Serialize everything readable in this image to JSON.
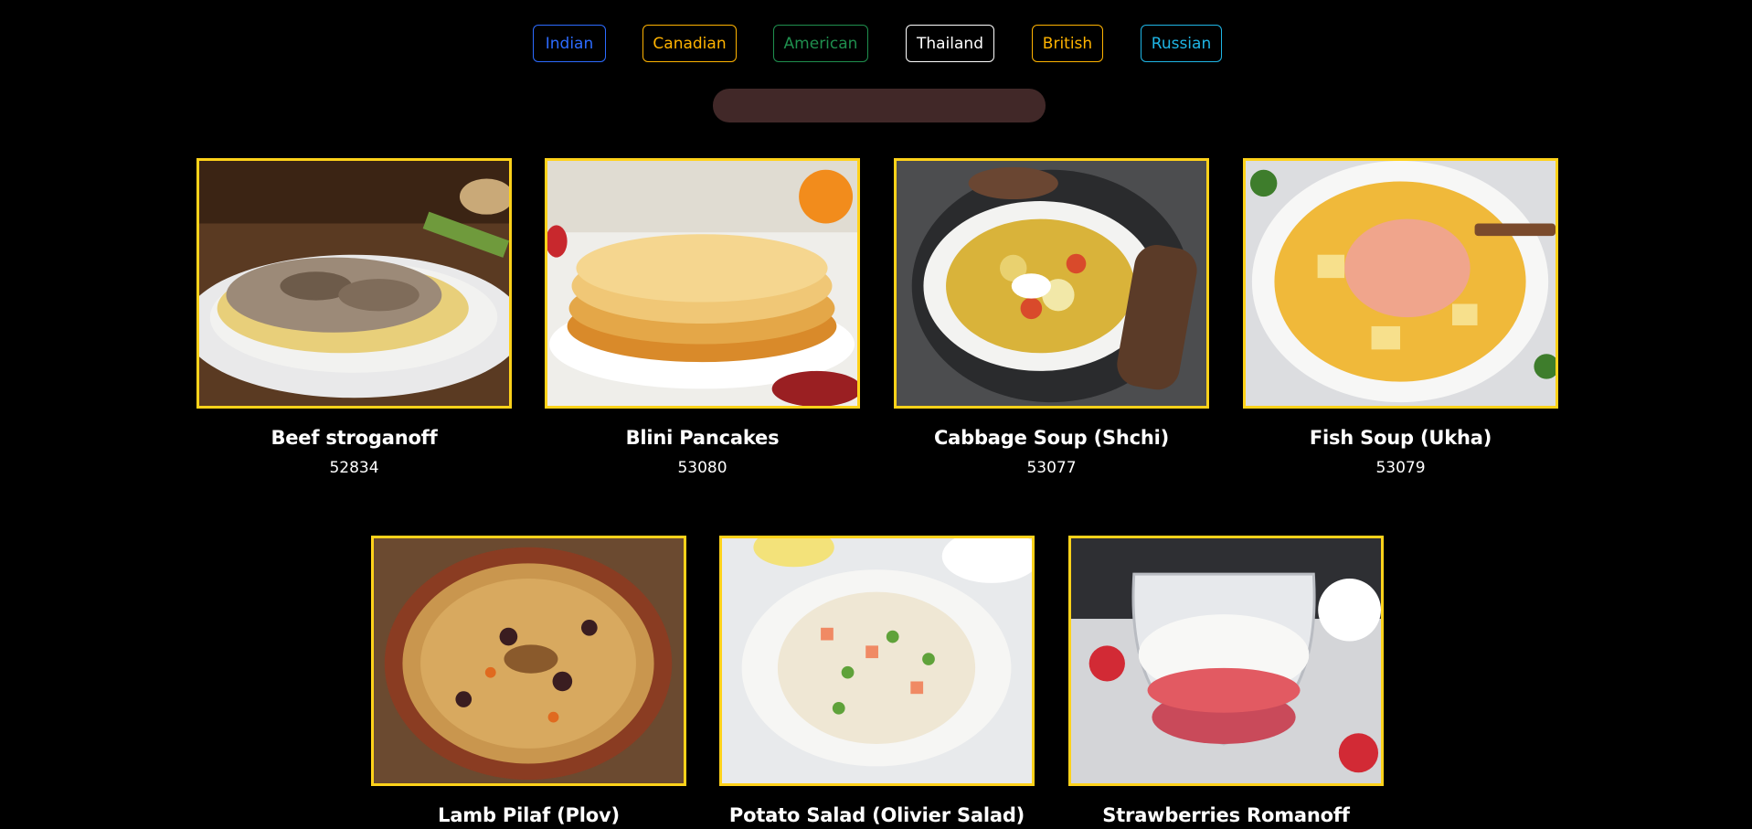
{
  "filters": [
    {
      "label": "Indian",
      "color": "#2c6bff"
    },
    {
      "label": "Canadian",
      "color": "#ffb300"
    },
    {
      "label": "American",
      "color": "#1f8f4e"
    },
    {
      "label": "Thailand",
      "color": "#ffffff"
    },
    {
      "label": "British",
      "color": "#ffb300"
    },
    {
      "label": "Russian",
      "color": "#1fb6e6"
    }
  ],
  "search": {
    "value": ""
  },
  "meals": [
    {
      "name": "Beef stroganoff",
      "id": "52834"
    },
    {
      "name": "Blini Pancakes",
      "id": "53080"
    },
    {
      "name": "Cabbage Soup (Shchi)",
      "id": "53077"
    },
    {
      "name": "Fish Soup (Ukha)",
      "id": "53079"
    },
    {
      "name": "Lamb Pilaf (Plov)",
      "id": ""
    },
    {
      "name": "Potato Salad (Olivier Salad)",
      "id": ""
    },
    {
      "name": "Strawberries Romanoff",
      "id": ""
    }
  ],
  "colors": {
    "background": "#000000",
    "card_border": "#ffd21a",
    "search_bg": "#412828"
  }
}
